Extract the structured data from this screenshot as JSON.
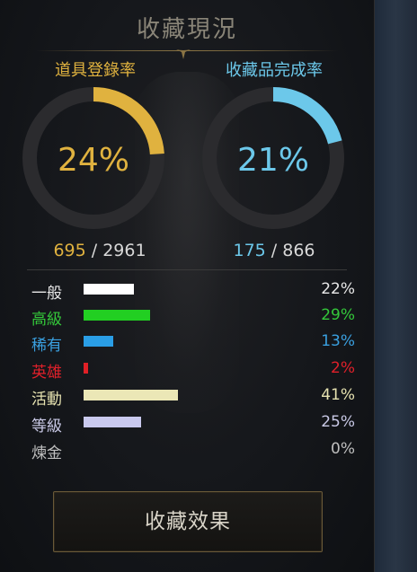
{
  "title": "收藏現況",
  "item_registration": {
    "label": "道具登錄率",
    "percent_text": "24%",
    "percent": 24,
    "current": "695",
    "separator": "/",
    "total": "2961",
    "color": "#e0b23f"
  },
  "collection_completion": {
    "label": "收藏品完成率",
    "percent_text": "21%",
    "percent": 21,
    "current": "175",
    "separator": "/",
    "total": "866",
    "color": "#6cc8ea"
  },
  "categories": [
    {
      "name": "一般",
      "pct_text": "22%",
      "pct": 22,
      "label_color": "#e8e8e8",
      "pct_color": "#e8e8e8",
      "bar_color": "#ffffff"
    },
    {
      "name": "高級",
      "pct_text": "29%",
      "pct": 29,
      "label_color": "#34c83a",
      "pct_color": "#34c83a",
      "bar_color": "#22cf22"
    },
    {
      "name": "稀有",
      "pct_text": "13%",
      "pct": 13,
      "label_color": "#3aa0e0",
      "pct_color": "#3aa0e0",
      "bar_color": "#2a9ee6"
    },
    {
      "name": "英雄",
      "pct_text": "2%",
      "pct": 2,
      "label_color": "#e0202a",
      "pct_color": "#e0202a",
      "bar_color": "#e02026"
    },
    {
      "name": "活動",
      "pct_text": "41%",
      "pct": 41,
      "label_color": "#e6e2b0",
      "pct_color": "#e6e2b0",
      "bar_color": "#ebe7b6"
    },
    {
      "name": "等級",
      "pct_text": "25%",
      "pct": 25,
      "label_color": "#c9c9e6",
      "pct_color": "#c9c9e6",
      "bar_color": "#c9c9ee"
    },
    {
      "name": "煉金",
      "pct_text": "0%",
      "pct": 0,
      "label_color": "#bfbfbf",
      "pct_color": "#bfbfbf",
      "bar_color": "#bfbfbf"
    }
  ],
  "effect_button": {
    "label": "收藏效果"
  }
}
